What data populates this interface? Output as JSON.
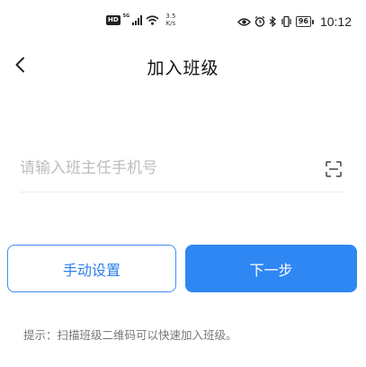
{
  "status_bar": {
    "hd_label": "HD",
    "network_label": "5G",
    "speed_value": "3.5",
    "speed_unit": "K/s",
    "battery_level": "96",
    "time": "10:12"
  },
  "header": {
    "title": "加入班级"
  },
  "form": {
    "phone_placeholder": "请输入班主任手机号",
    "phone_value": ""
  },
  "buttons": {
    "manual_label": "手动设置",
    "next_label": "下一步"
  },
  "hint": {
    "text": "提示：扫描班级二维码可以快速加入班级。"
  },
  "colors": {
    "primary": "#2f87f3",
    "outline": "#3d8ef7",
    "hint_text": "#777777",
    "placeholder": "#bdbdbd"
  }
}
